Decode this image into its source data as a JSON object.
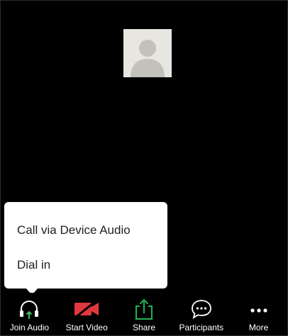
{
  "popup": {
    "items": [
      {
        "label": "Call via Device Audio"
      },
      {
        "label": "Dial in"
      }
    ]
  },
  "toolbar": {
    "items": [
      {
        "label": "Join Audio",
        "icon": "headphones-icon"
      },
      {
        "label": "Start Video",
        "icon": "video-off-icon"
      },
      {
        "label": "Share",
        "icon": "share-icon"
      },
      {
        "label": "Participants",
        "icon": "participants-chat-icon"
      },
      {
        "label": "More",
        "icon": "more-icon"
      }
    ]
  },
  "colors": {
    "background": "#000000",
    "video_off_red": "#e0383e",
    "share_green": "#21b25a",
    "join_audio_arrow_green": "#3ec35f",
    "avatar_bg": "#e8e6e1",
    "avatar_silhouette": "#c3c1bb"
  }
}
